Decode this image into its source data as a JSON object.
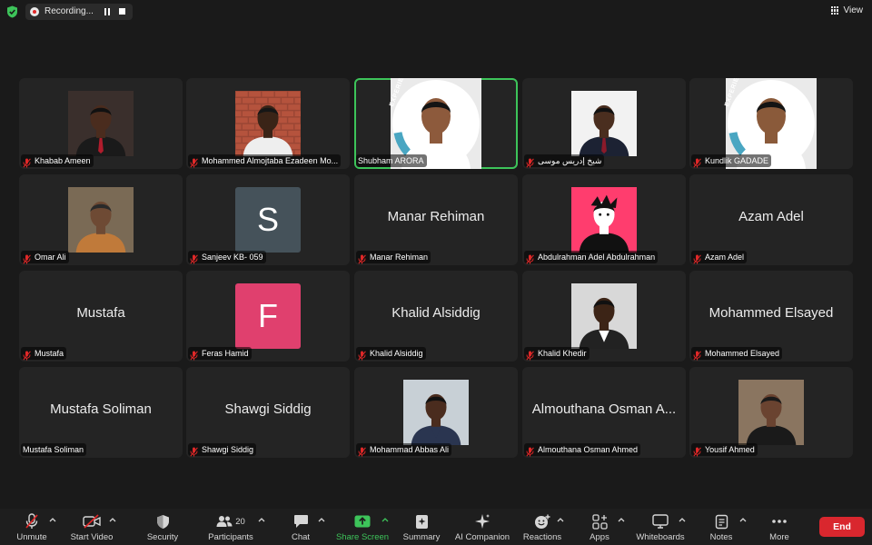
{
  "topbar": {
    "recording_label": "Recording...",
    "view_label": "View",
    "icons": [
      "shield-check-icon",
      "record-dot-icon",
      "pause-icon",
      "stop-icon",
      "grid-view-icon"
    ]
  },
  "colors": {
    "active_speaker": "#3dc45a",
    "end_button": "#d9272e",
    "share_screen": "#3dc45a",
    "tile_bg": "#242424"
  },
  "participants": [
    {
      "name": "Khabab Ameen",
      "video": "photo",
      "muted": true
    },
    {
      "name": "Mohammed Almojtaba Ezadeen Mo...",
      "video": "photo",
      "muted": true
    },
    {
      "name": "Shubham ARORA",
      "video": "photo",
      "muted": false,
      "active": true,
      "badge": "Champion",
      "ring_text": "EXPERIENCE"
    },
    {
      "name": "شيخ إدريس موسى",
      "video": "photo",
      "muted": true
    },
    {
      "name": "Kundlik GADADE",
      "video": "photo",
      "muted": true,
      "badge": "Champion",
      "ring_text": "EXPERIENCE"
    },
    {
      "name": "Omar Ali",
      "video": "photo",
      "muted": true
    },
    {
      "name": "Sanjeev KB- 059",
      "video": "letter",
      "letter": "S",
      "letter_color": "#45525a",
      "muted": true
    },
    {
      "name": "Manar Rehiman",
      "video": "name",
      "display": "Manar Rehiman",
      "muted": true
    },
    {
      "name": "Abdulrahman Adel Abdulrahman",
      "video": "photo",
      "muted": true
    },
    {
      "name": "Azam Adel",
      "video": "name",
      "display": "Azam Adel",
      "muted": true
    },
    {
      "name": "Mustafa",
      "video": "name",
      "display": "Mustafa",
      "muted": true
    },
    {
      "name": "Feras Hamid",
      "video": "letter",
      "letter": "F",
      "letter_color": "#e0406e",
      "muted": true
    },
    {
      "name": "Khalid Alsiddig",
      "video": "name",
      "display": "Khalid Alsiddig",
      "muted": true
    },
    {
      "name": "Khalid Khedir",
      "video": "photo",
      "muted": true
    },
    {
      "name": "Mohammed Elsayed",
      "video": "name",
      "display": "Mohammed Elsayed",
      "muted": true
    },
    {
      "name": "Mustafa Soliman",
      "video": "name",
      "display": "Mustafa Soliman",
      "muted": false
    },
    {
      "name": "Shawgi Siddig",
      "video": "name",
      "display": "Shawgi Siddig",
      "muted": true
    },
    {
      "name": "Mohammad Abbas Ali",
      "video": "photo",
      "muted": true
    },
    {
      "name": "Almouthana Osman Ahmed",
      "video": "name",
      "display": "Almouthana Osman A...",
      "muted": true
    },
    {
      "name": "Yousif Ahmed",
      "video": "photo",
      "muted": true
    }
  ],
  "toolbar": {
    "unmute": "Unmute",
    "start_video": "Start Video",
    "security": "Security",
    "participants": "Participants",
    "participants_count": "20",
    "chat": "Chat",
    "share_screen": "Share Screen",
    "summary": "Summary",
    "ai_companion": "AI Companion",
    "reactions": "Reactions",
    "apps": "Apps",
    "whiteboards": "Whiteboards",
    "notes": "Notes",
    "more": "More",
    "end": "End"
  }
}
